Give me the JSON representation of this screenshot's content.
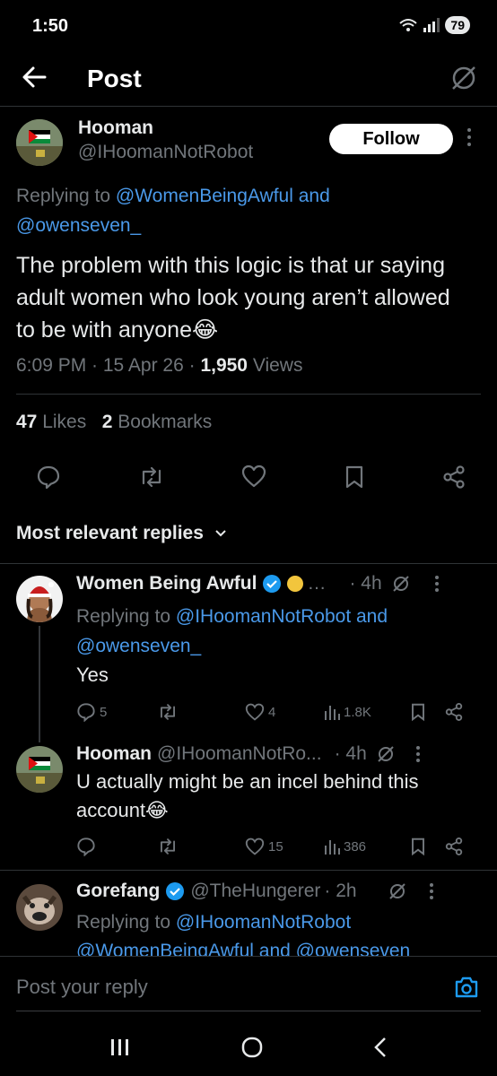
{
  "status": {
    "time": "1:50",
    "network": "6",
    "battery": "79"
  },
  "header": {
    "title": "Post"
  },
  "post": {
    "author_name": "Hooman",
    "author_handle": "@IHoomanNotRobot",
    "follow_label": "Follow",
    "replying_prefix": "Replying to ",
    "replying_to_1": "@WomenBeingAwful",
    "replying_and": " and",
    "replying_to_2": "@owenseven_",
    "text": "The problem with this logic is that ur saying adult women who look young aren’t allowed to be with anyone😂",
    "time": "6:09 PM · 15 Apr 26 · ",
    "views_count": "1,950",
    "views_label": " Views",
    "likes_count": "47",
    "likes_label": " Likes",
    "bookmarks_count": "2",
    "bookmarks_label": " Bookmarks"
  },
  "replies_header": "Most relevant replies",
  "replies": [
    {
      "name": "Women Being Awful",
      "handle": "…",
      "time": "· 4h",
      "replying_prefix": "Replying to ",
      "replying_to_1": "@IHoomanNotRobot",
      "replying_and": " and",
      "replying_to_2": "@owenseven_",
      "text": "Yes",
      "replies": "5",
      "likes": "4",
      "views": "1.8K"
    },
    {
      "name": "Hooman",
      "handle": "@IHoomanNotRo...",
      "time": "· 4h",
      "text": "U actually might be an incel behind this account😂",
      "likes": "15",
      "views": "386"
    },
    {
      "name": "Gorefang",
      "handle": "@TheHungerer",
      "time": "· 2h",
      "replying_prefix": "Replying to ",
      "replying_to_1": "@IHoomanNotRobot",
      "replying_to_2": "@WomenBeingAwful and @owenseven"
    }
  ],
  "reply_input": {
    "placeholder": "Post your reply"
  },
  "colors": {
    "accent": "#1d9bf0",
    "link": "#4a99e9",
    "muted": "#71767b",
    "background": "#000000"
  }
}
